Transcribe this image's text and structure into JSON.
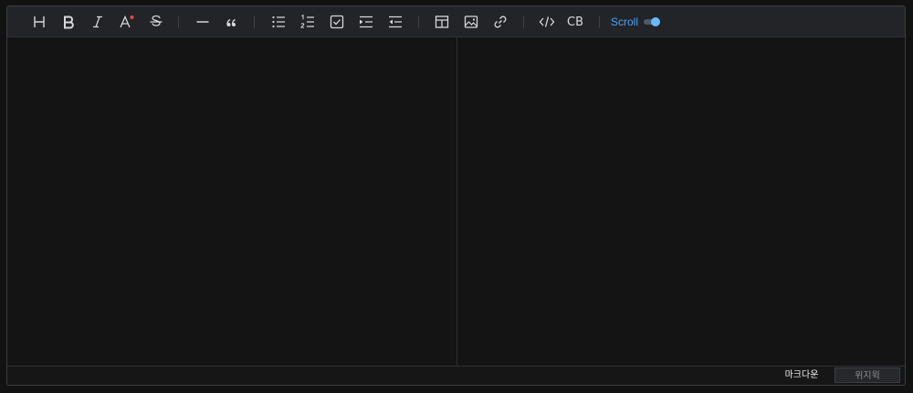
{
  "toolbar": {
    "items": [
      {
        "icon": "heading-icon"
      },
      {
        "icon": "bold-icon"
      },
      {
        "icon": "italic-icon"
      },
      {
        "icon": "text-color-icon"
      },
      {
        "icon": "strikethrough-icon"
      },
      {
        "icon": "horizontal-rule-icon"
      },
      {
        "icon": "blockquote-icon"
      },
      {
        "icon": "bullet-list-icon"
      },
      {
        "icon": "ordered-list-icon"
      },
      {
        "icon": "task-list-icon"
      },
      {
        "icon": "indent-icon"
      },
      {
        "icon": "outdent-icon"
      },
      {
        "icon": "table-icon"
      },
      {
        "icon": "image-icon"
      },
      {
        "icon": "link-icon"
      },
      {
        "icon": "code-icon"
      },
      {
        "icon": "code-block-icon"
      }
    ],
    "code_block_label": "CB",
    "scroll_label": "Scroll",
    "scroll_sync_enabled": true,
    "accent_color": "#4aa3f5",
    "text_color_dot": "#e5484d"
  },
  "footer": {
    "markdown_tab_label": "마크다운",
    "wysiwyg_tab_label": "위지윅",
    "active_tab": "markdown"
  }
}
